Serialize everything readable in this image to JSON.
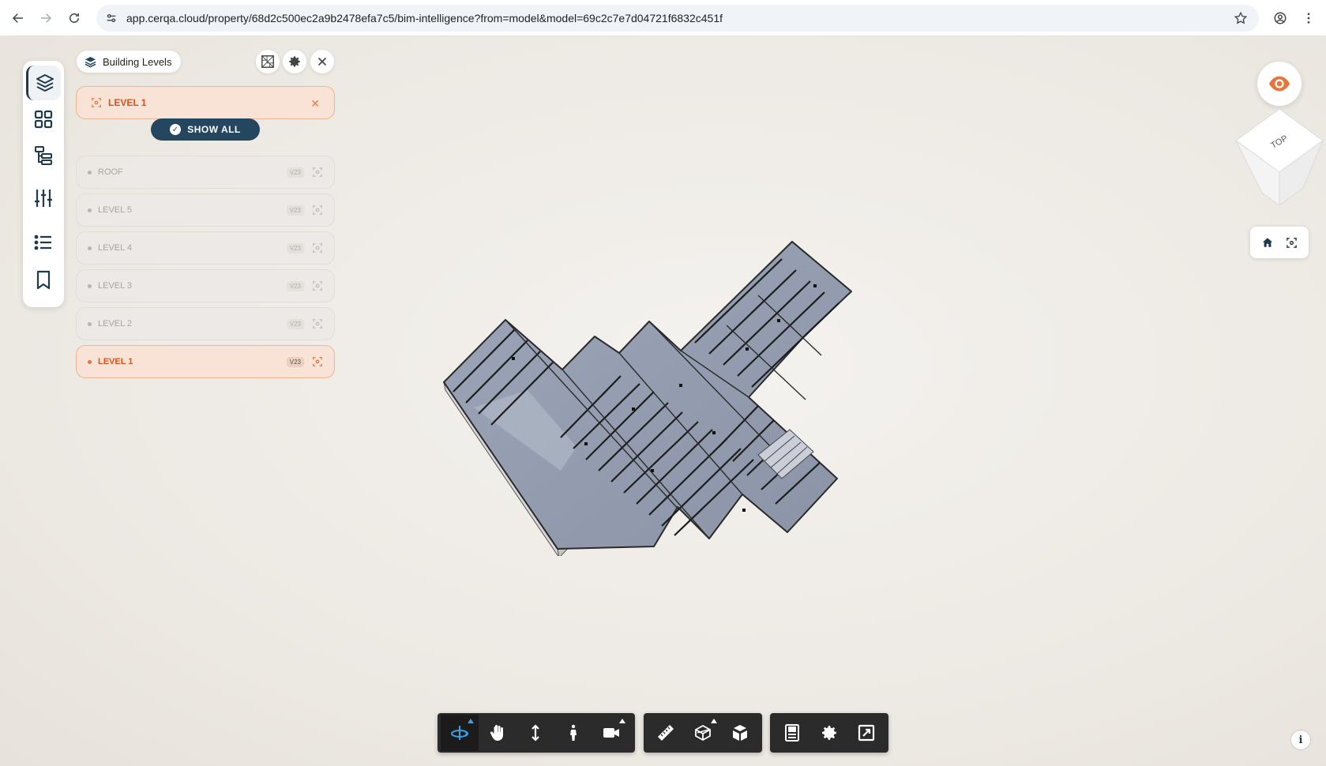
{
  "browser": {
    "url": "app.cerqa.cloud/property/68d2c500ec2a9b2478efa7c5/bim-intelligence?from=model&model=69c2c7e7d04721f6832c451f"
  },
  "rail": {
    "items": [
      "layers-icon",
      "grid-icon",
      "hierarchy-icon",
      "sliders-icon",
      "list-icon",
      "bookmark-icon"
    ],
    "active_index": 0
  },
  "panel": {
    "title": "Building Levels",
    "selected_level": "LEVEL 1",
    "show_all_label": "SHOW ALL",
    "levels": [
      {
        "name": "ROOF",
        "badge": "V23",
        "active": false
      },
      {
        "name": "LEVEL 5",
        "badge": "V23",
        "active": false
      },
      {
        "name": "LEVEL 4",
        "badge": "V23",
        "active": false
      },
      {
        "name": "LEVEL 3",
        "badge": "V23",
        "active": false
      },
      {
        "name": "LEVEL 2",
        "badge": "V23",
        "active": false
      },
      {
        "name": "LEVEL 1",
        "badge": "V23",
        "active": true
      }
    ]
  },
  "view_cube": {
    "face_label": "TOP"
  },
  "toolbar": {
    "group1": [
      "orbit-icon",
      "pan-icon",
      "zoom-icon",
      "walk-icon",
      "camera-icon"
    ],
    "group2": [
      "measure-icon",
      "section-icon",
      "explode-icon"
    ],
    "group3": [
      "properties-icon",
      "settings-icon",
      "fullscreen-icon"
    ],
    "active_tool": "orbit-icon"
  },
  "colors": {
    "accent": "#e8743a",
    "primary": "#24465e",
    "toolbar": "#2b2b2b",
    "active_tool": "#3aa0e8"
  }
}
